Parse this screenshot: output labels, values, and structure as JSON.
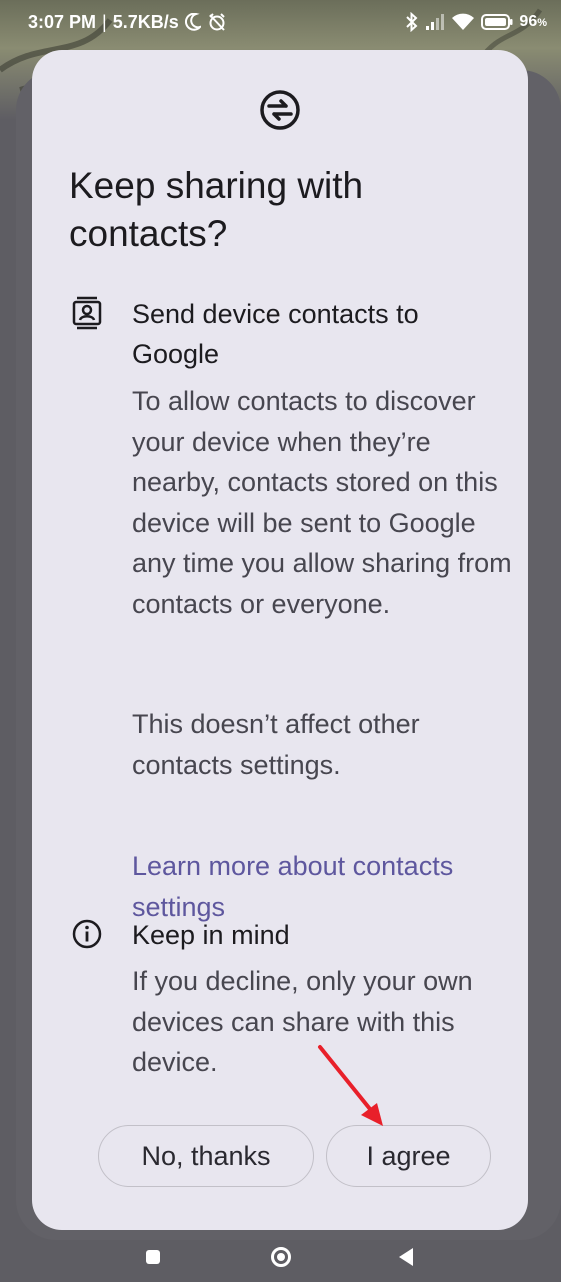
{
  "status_bar": {
    "time": "3:07 PM",
    "separator": "|",
    "network_speed": "5.7KB/s",
    "icons": [
      "moon-icon",
      "alarm-off-icon",
      "bluetooth-icon",
      "signal-icon",
      "wifi-icon",
      "battery-icon"
    ],
    "battery_percent": "96",
    "battery_unit": "%"
  },
  "dialog": {
    "icon": "nearby-share-icon",
    "title": "Keep sharing with contacts?",
    "sections": [
      {
        "icon": "contact-card-icon",
        "heading": "Send device contacts to Google",
        "body": "To allow contacts to discover your device when they’re nearby, contacts stored on this device will be sent to Google any time you allow sharing from contacts or everyone.",
        "note": "This doesn’t affect other contacts settings.",
        "link": "Learn more about contacts settings"
      },
      {
        "icon": "info-icon",
        "heading": "Keep in mind",
        "body": "If you decline, only your own devices can share with this device."
      }
    ],
    "buttons": {
      "decline": "No, thanks",
      "agree": "I agree"
    }
  },
  "colors": {
    "dialog_bg": "#e8e6ef",
    "link": "#5e579e",
    "annotation_arrow": "#e8202a"
  },
  "nav_bar": {
    "icons": [
      "recents-square-icon",
      "home-circle-icon",
      "back-triangle-icon"
    ]
  }
}
